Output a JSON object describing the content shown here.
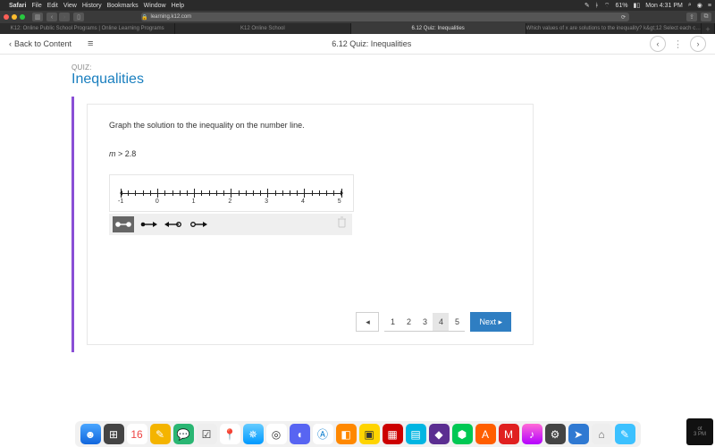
{
  "menubar": {
    "app": "Safari",
    "items": [
      "File",
      "Edit",
      "View",
      "History",
      "Bookmarks",
      "Window",
      "Help"
    ],
    "battery_pct": "61%",
    "clock": "Mon 4:31 PM"
  },
  "browser": {
    "url_host": "learning.k12.com",
    "tabs": [
      "K12: Online Public School Programs | Online Learning Programs",
      "K12 Online School",
      "6.12 Quiz: Inequalities",
      "Which values of x are solutions to the inequality? k&gt;12 Select each c…"
    ],
    "active_tab_index": 2
  },
  "header": {
    "back_label": "Back to Content",
    "title": "6.12 Quiz: Inequalities"
  },
  "quiz": {
    "label": "QUIZ:",
    "title": "Inequalities",
    "instruction": "Graph the solution to the inequality on the number line.",
    "variable": "m",
    "relation_text": " > 2.8",
    "axis_labels": [
      "-1",
      "0",
      "1",
      "2",
      "3",
      "4",
      "5"
    ],
    "tools": [
      "closed-closed",
      "closed-right",
      "open-closed",
      "open-right"
    ],
    "selected_tool_index": 0
  },
  "pager": {
    "pages": [
      "1",
      "2",
      "3",
      "4",
      "5"
    ],
    "current": "4",
    "next_label": "Next ▸",
    "prev_label": "◂"
  },
  "clock_widget": {
    "line1": "ot",
    "line2": "3 PM"
  }
}
